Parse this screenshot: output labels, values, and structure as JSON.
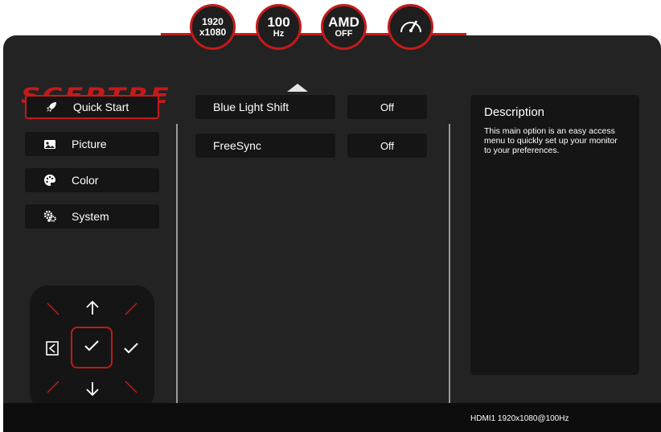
{
  "brand": {
    "logo_text": "SCEPTRE",
    "accent_color": "#c41a1a"
  },
  "status": {
    "resolution_line1": "1920",
    "resolution_line2": "x1080",
    "refresh_value": "100",
    "refresh_unit": "Hz",
    "amd_label": "AMD",
    "amd_state": "OFF",
    "gauge_icon": "speedometer-icon"
  },
  "menu": [
    {
      "label": "Quick Start",
      "icon": "rocket-icon",
      "active": true
    },
    {
      "label": "Picture",
      "icon": "picture-icon",
      "active": false
    },
    {
      "label": "Color",
      "icon": "palette-icon",
      "active": false
    },
    {
      "label": "System",
      "icon": "gears-icon",
      "active": false
    }
  ],
  "options": [
    {
      "label": "Blue Light Shift",
      "value": "Off"
    },
    {
      "label": "FreeSync",
      "value": "Off"
    }
  ],
  "description": {
    "title": "Description",
    "text": "This main option is an easy access menu to quickly set up your monitor to your preferences."
  },
  "footer": {
    "signal": "HDMI1 1920x1080@100Hz"
  },
  "navpad": {
    "up_icon": "arrow-up-icon",
    "down_icon": "arrow-down-icon",
    "exit_icon": "exit-icon",
    "select_icon": "checkmark-icon",
    "right_icon": "checkmark-icon"
  }
}
